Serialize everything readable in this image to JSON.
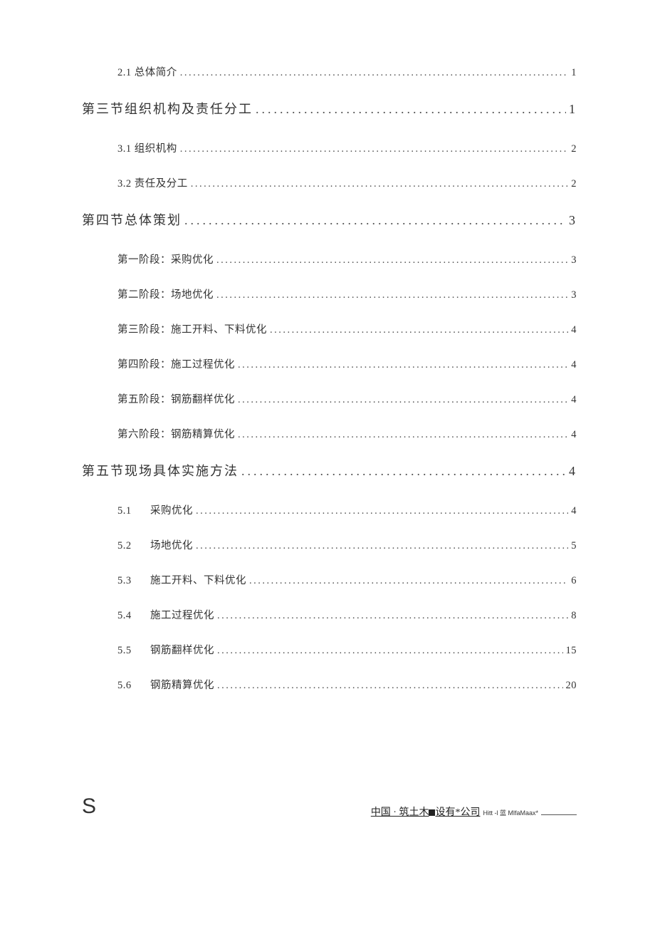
{
  "toc": [
    {
      "level": 2,
      "label": "2.1 总体简介",
      "page": "1"
    },
    {
      "level": 1,
      "label": "第三节组织机构及责任分工",
      "page": "1"
    },
    {
      "level": 2,
      "label": "3.1 组织机构",
      "page": "2"
    },
    {
      "level": 2,
      "label": "3.2 责任及分工",
      "page": "2"
    },
    {
      "level": 1,
      "label": "第四节总体策划",
      "page": "3"
    },
    {
      "level": 2,
      "label": "第一阶段：采购优化",
      "page": "3"
    },
    {
      "level": 2,
      "label": "第二阶段：场地优化",
      "page": "3"
    },
    {
      "level": 2,
      "label": "第三阶段：施工开料、下料优化",
      "page": "4"
    },
    {
      "level": 2,
      "label": "第四阶段：施工过程优化",
      "page": "4"
    },
    {
      "level": 2,
      "label": "第五阶段：钢筋翻样优化",
      "page": "4"
    },
    {
      "level": 2,
      "label": "第六阶段：钢筋精算优化",
      "page": "4"
    },
    {
      "level": 1,
      "label": "第五节现场具体实施方法",
      "page": "4"
    },
    {
      "level": 2,
      "label": "5.1",
      "suffix": "采购优化",
      "page": "4"
    },
    {
      "level": 2,
      "label": "5.2",
      "suffix": "场地优化",
      "page": "5"
    },
    {
      "level": 2,
      "label": "5.3",
      "suffix": "施工开料、下料优化",
      "page": "6"
    },
    {
      "level": 2,
      "label": "5.4",
      "suffix": "施工过程优化",
      "page": "8"
    },
    {
      "level": 2,
      "label": "5.5",
      "suffix": "钢筋翻样优化",
      "page": "15"
    },
    {
      "level": 2,
      "label": "5.6",
      "suffix": "钢筋精算优化",
      "page": "20"
    }
  ],
  "footer": {
    "left": "S",
    "company_prefix": "中国 · 筑土木",
    "company_mid": "设有*公司",
    "small": "Hitt  -l 蓝 MlfaMaax*"
  }
}
